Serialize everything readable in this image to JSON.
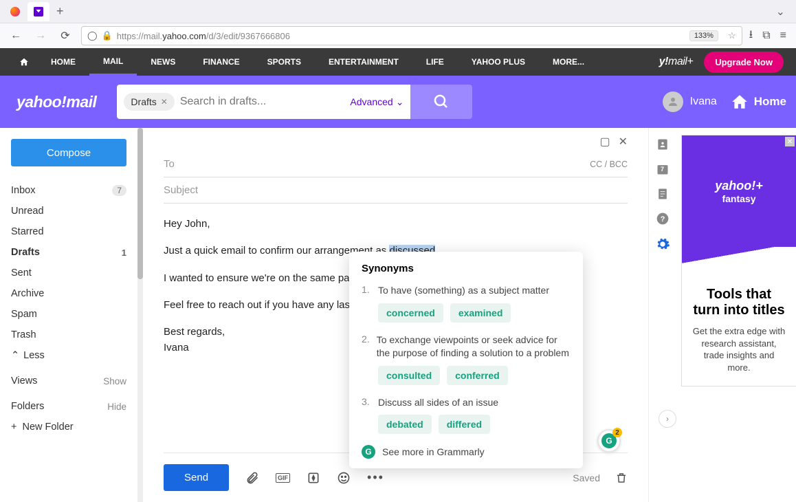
{
  "browser": {
    "url_prefix": "https://mail.",
    "url_domain": "yahoo.com",
    "url_path": "/d/3/edit/9367666806",
    "zoom": "133%"
  },
  "topnav": {
    "home": "HOME",
    "items": [
      "MAIL",
      "NEWS",
      "FINANCE",
      "SPORTS",
      "ENTERTAINMENT",
      "LIFE",
      "YAHOO PLUS",
      "MORE..."
    ],
    "mailplus_prefix": "y!",
    "mailplus_suffix": "mail+",
    "upgrade": "Upgrade Now"
  },
  "header": {
    "logo": "yahoo!mail",
    "chip": "Drafts",
    "search_placeholder": "Search in drafts...",
    "advanced": "Advanced",
    "user": "Ivana",
    "home": "Home"
  },
  "sidebar": {
    "compose": "Compose",
    "folders": [
      {
        "label": "Inbox",
        "count": "7",
        "badge": true
      },
      {
        "label": "Unread"
      },
      {
        "label": "Starred"
      },
      {
        "label": "Drafts",
        "count": "1",
        "bold": true
      },
      {
        "label": "Sent"
      },
      {
        "label": "Archive"
      },
      {
        "label": "Spam"
      },
      {
        "label": "Trash"
      }
    ],
    "less": "Less",
    "views": "Views",
    "views_action": "Show",
    "folders_label": "Folders",
    "folders_action": "Hide",
    "new_folder": "New Folder"
  },
  "compose": {
    "to_label": "To",
    "ccbcc": "CC / BCC",
    "subject_placeholder": "Subject",
    "body": {
      "l1": "Hey John,",
      "l2a": "Just a quick email to confirm our arrangement as ",
      "l2_hl": "discussed",
      "l2b": ".",
      "l3": "I wanted to ensure we're on the same page and",
      "l4": "Feel free to reach out if you have any last-minu",
      "l5": "Best regards,",
      "l6": "Ivana"
    },
    "send": "Send",
    "saved": "Saved"
  },
  "grammarly": {
    "title": "Synonyms",
    "defs": [
      {
        "n": "1.",
        "text": "To have (something) as a subject matter",
        "chips": [
          "concerned",
          "examined"
        ]
      },
      {
        "n": "2.",
        "text": "To exchange viewpoints or seek advice for the purpose of finding a solution to a problem",
        "chips": [
          "consulted",
          "conferred"
        ]
      },
      {
        "n": "3.",
        "text": "Discuss all sides of an issue",
        "chips": [
          "debated",
          "differed"
        ]
      }
    ],
    "more": "See more in Grammarly",
    "fab_count": "2"
  },
  "ad": {
    "brand1": "yahoo!+",
    "brand2": "fantasy",
    "headline": "Tools that turn into titles",
    "body": "Get the extra edge with research assistant, trade insights and more."
  }
}
